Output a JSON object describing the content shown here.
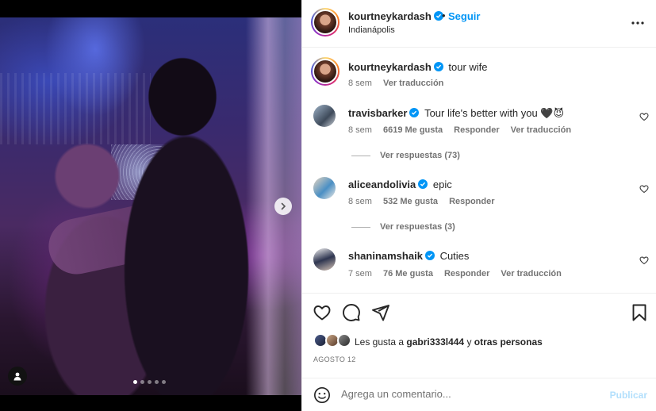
{
  "post": {
    "author": "kourtneykardash",
    "location": "Indianápolis",
    "follow_label": "Seguir",
    "separator": "•",
    "carousel_count": 5,
    "carousel_active": 0
  },
  "caption": {
    "user": "kourtneykardash",
    "text": "tour wife",
    "time": "8 sem",
    "translate": "Ver traducción"
  },
  "comments": [
    {
      "user": "travisbarker",
      "text": "Tour life's better with you 🖤😈",
      "time": "8 sem",
      "likes": "6619 Me gusta",
      "reply": "Responder",
      "translate": "Ver traducción",
      "replies": "Ver respuestas (73)"
    },
    {
      "user": "aliceandolivia",
      "text": "epic",
      "time": "8 sem",
      "likes": "532 Me gusta",
      "reply": "Responder",
      "replies": "Ver respuestas (3)"
    },
    {
      "user": "shaninamshaik",
      "text": "Cuties",
      "time": "7 sem",
      "likes": "76 Me gusta",
      "reply": "Responder",
      "translate": "Ver traducción"
    }
  ],
  "likes": {
    "prefix": "Les gusta a ",
    "user": "gabri333l444",
    "middle": " y ",
    "others": "otras personas"
  },
  "date": "AGOSTO 12",
  "compose": {
    "placeholder": "Agrega un comentario...",
    "publish": "Publicar"
  },
  "icons": {
    "more": "more-horizontal-icon",
    "next": "chevron-right-icon",
    "tag": "user-tag-icon",
    "like": "heart-icon",
    "comment": "comment-icon",
    "share": "send-icon",
    "save": "bookmark-icon",
    "emoji": "emoji-icon"
  },
  "colors": {
    "accent": "#0095f6",
    "verified": "#0095f6",
    "muted": "#737373",
    "publish_disabled": "#b2dffc"
  }
}
